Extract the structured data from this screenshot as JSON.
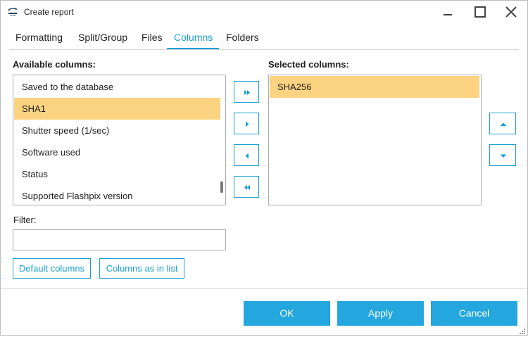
{
  "window": {
    "title": "Create report"
  },
  "tabs": [
    {
      "label": "Formatting"
    },
    {
      "label": "Split/Group"
    },
    {
      "label": "Files"
    },
    {
      "label": "Columns",
      "active": true
    },
    {
      "label": "Folders"
    }
  ],
  "available": {
    "label": "Available columns:",
    "items": [
      {
        "label": "Saved to the database"
      },
      {
        "label": "SHA1",
        "selected": true
      },
      {
        "label": "Shutter speed (1/sec)"
      },
      {
        "label": "Software used"
      },
      {
        "label": "Status"
      },
      {
        "label": "Supported Flashpix version"
      }
    ]
  },
  "selected": {
    "label": "Selected columns:",
    "items": [
      {
        "label": "SHA256",
        "selected": true
      }
    ]
  },
  "transfer_buttons": [
    {
      "icon": "double-chevron-right-icon"
    },
    {
      "icon": "triangle-right-icon"
    },
    {
      "icon": "triangle-left-icon"
    },
    {
      "icon": "double-chevron-left-icon"
    }
  ],
  "order_buttons": [
    {
      "icon": "triangle-up-icon"
    },
    {
      "icon": "triangle-down-icon"
    }
  ],
  "filter": {
    "label": "Filter:",
    "value": "",
    "placeholder": ""
  },
  "links": {
    "default_columns": "Default columns",
    "columns_as_in_list": "Columns as in list"
  },
  "footer": {
    "ok": "OK",
    "apply": "Apply",
    "cancel": "Cancel"
  },
  "colors": {
    "accent": "#1a9fd4",
    "button_fill": "#24a6df",
    "selection": "#fcd381"
  }
}
